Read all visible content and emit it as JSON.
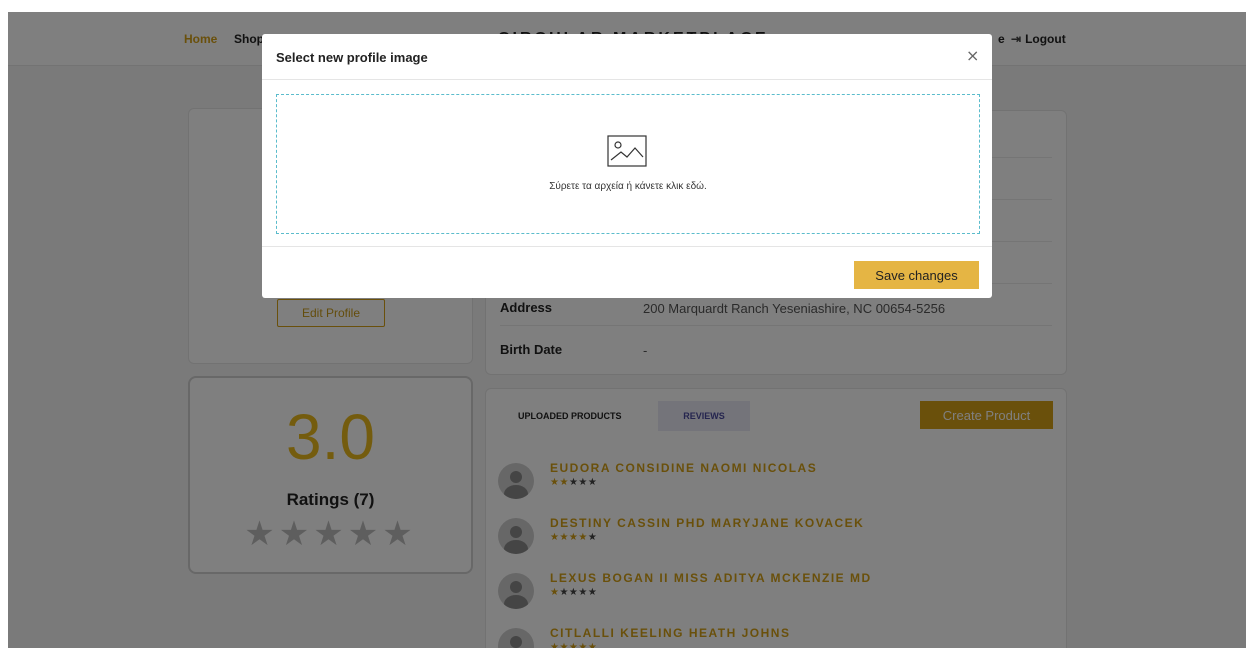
{
  "nav": {
    "home": "Home",
    "shop": "Shop",
    "brand": "CIRCULAR MARKETPLACE",
    "right_fragment": "e",
    "logout": "Logout"
  },
  "profile": {
    "edit_label": "Edit Profile"
  },
  "details": {
    "address_label": "Address",
    "address_value": "200 Marquardt Ranch Yeseniashire, NC 00654-5256",
    "birth_label": "Birth Date",
    "birth_value": "-"
  },
  "rating": {
    "value": "3.0",
    "label": "Ratings (7)",
    "stars": "★★★★★"
  },
  "products": {
    "tab_uploaded": "UPLOADED PRODUCTS",
    "tab_reviews": "REVIEWS",
    "create_label": "Create Product",
    "reviews": [
      {
        "name": "EUDORA CONSIDINE NAOMI NICOLAS",
        "stars_on": "★★",
        "stars_off": "★★★",
        "rating": 2
      },
      {
        "name": "DESTINY CASSIN PHD MARYJANE KOVACEK",
        "stars_on": "★★★★",
        "stars_off": "★",
        "rating": 4
      },
      {
        "name": "LEXUS BOGAN II MISS ADITYA MCKENZIE MD",
        "stars_on": "★",
        "stars_off": "★★★★",
        "rating": 1
      },
      {
        "name": "CITLALLI KEELING HEATH JOHNS",
        "stars_on": "★★★★★",
        "stars_off": "",
        "rating": 5
      }
    ]
  },
  "modal": {
    "title": "Select new profile image",
    "close": "×",
    "dropzone_text": "Σύρετε τα αρχεία ή κάνετε κλικ εδώ.",
    "save_label": "Save changes"
  },
  "colors": {
    "accent": "#d4a017",
    "save_button": "#e5b544",
    "dropzone_border": "#5bbccc",
    "overlay": "rgba(0,0,0,0.5)"
  }
}
